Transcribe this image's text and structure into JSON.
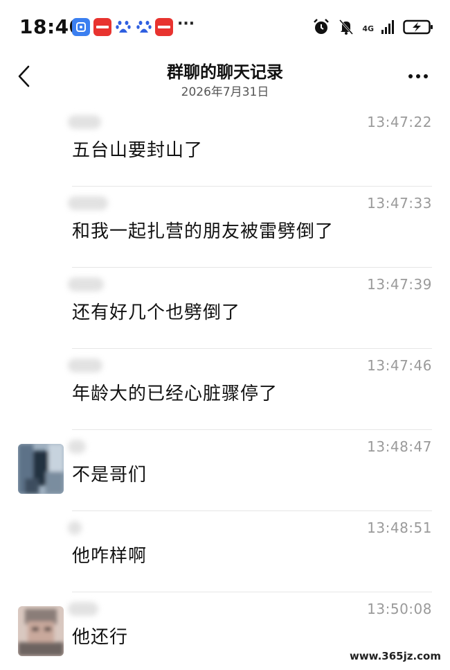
{
  "status_bar": {
    "time": "18:40",
    "more": "···",
    "network": "4G",
    "app_icons": [
      "wallet-app-icon",
      "xiaohongshu-icon",
      "baidu-icon",
      "baidu-icon",
      "xiaohongshu-icon"
    ]
  },
  "nav": {
    "title": "群聊的聊天记录",
    "subtitle": "2026年7月31日",
    "back_icon": "chevron-left-icon",
    "more_icon": "more-dots-icon"
  },
  "messages": [
    {
      "time": "13:47:22",
      "text": "五台山要封山了",
      "has_avatar": false
    },
    {
      "time": "13:47:33",
      "text": "和我一起扎营的朋友被雷劈倒了",
      "has_avatar": false
    },
    {
      "time": "13:47:39",
      "text": "还有好几个也劈倒了",
      "has_avatar": false
    },
    {
      "time": "13:47:46",
      "text": "年龄大的已经心脏骤停了",
      "has_avatar": false
    },
    {
      "time": "13:48:47",
      "text": "不是哥们",
      "has_avatar": true
    },
    {
      "time": "13:48:51",
      "text": "他咋样啊",
      "has_avatar": false
    },
    {
      "time": "13:50:08",
      "text": "他还行",
      "has_avatar": true
    }
  ],
  "watermark": "www.365jz.com"
}
